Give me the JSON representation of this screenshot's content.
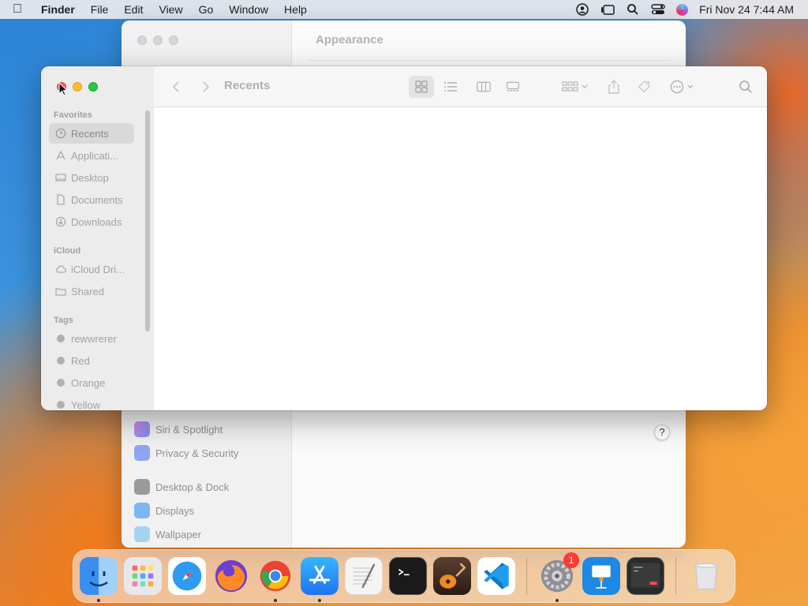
{
  "menubar": {
    "app_name": "Finder",
    "items": [
      "File",
      "Edit",
      "View",
      "Go",
      "Window",
      "Help"
    ],
    "clock": "Fri Nov 24  7:44 AM"
  },
  "settings_window": {
    "title": "Appearance",
    "sidebar_items": [
      {
        "label": "Siri & Spotlight",
        "color": "#b67ae0"
      },
      {
        "label": "Privacy & Security",
        "color": "#6e8ff0"
      },
      {
        "label": "Desktop & Dock",
        "color": "#7a7a7a"
      },
      {
        "label": "Displays",
        "color": "#5aa3f0"
      },
      {
        "label": "Wallpaper",
        "color": "#7fc1e8"
      }
    ],
    "help_label": "?"
  },
  "finder": {
    "title": "Recents",
    "sections": {
      "favorites": "Favorites",
      "icloud": "iCloud",
      "tags": "Tags"
    },
    "favorites": [
      {
        "label": "Recents",
        "icon": "clock-icon"
      },
      {
        "label": "Applicati...",
        "icon": "applications-icon"
      },
      {
        "label": "Desktop",
        "icon": "desktop-icon"
      },
      {
        "label": "Documents",
        "icon": "document-icon"
      },
      {
        "label": "Downloads",
        "icon": "download-icon"
      }
    ],
    "icloud": [
      {
        "label": "iCloud Dri...",
        "icon": "cloud-icon"
      },
      {
        "label": "Shared",
        "icon": "shared-folder-icon"
      }
    ],
    "tags": [
      "rewwrerer",
      "Red",
      "Orange",
      "Yellow"
    ]
  },
  "dock": {
    "apps": [
      {
        "name": "Finder",
        "color": "#3a8ef0"
      },
      {
        "name": "Launchpad",
        "color": "#e8e8ea"
      },
      {
        "name": "Safari",
        "color": "#2e9bf0"
      },
      {
        "name": "Firefox",
        "color": "#6a3fd1"
      },
      {
        "name": "Chrome",
        "color": "#ffffff"
      },
      {
        "name": "App Store",
        "color": "#1e8ef5"
      },
      {
        "name": "TextEdit",
        "color": "#f4f4f4"
      },
      {
        "name": "Terminal",
        "color": "#1a1a1a"
      },
      {
        "name": "GarageBand",
        "color": "#3a2a20"
      },
      {
        "name": "VS Code",
        "color": "#ffffff"
      }
    ],
    "system_apps": [
      {
        "name": "System Settings",
        "color": "#8e8e93",
        "badge": "1"
      },
      {
        "name": "Keynote",
        "color": "#1e88e5"
      },
      {
        "name": "Console",
        "color": "#2a2a2a"
      }
    ],
    "trash": {
      "name": "Trash",
      "color": "#dcdce0"
    }
  }
}
